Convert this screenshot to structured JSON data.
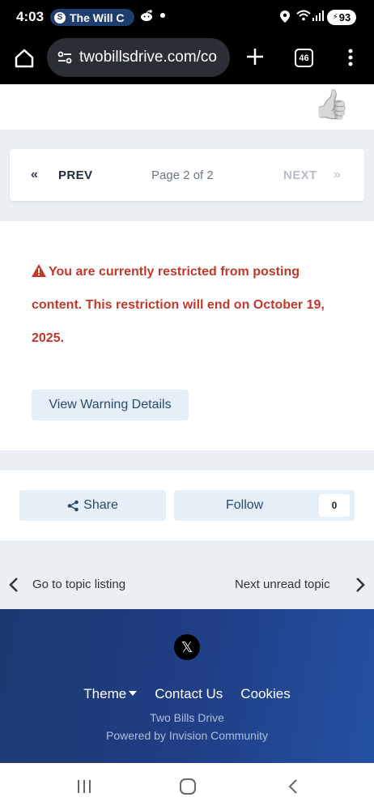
{
  "status_bar": {
    "time": "4:03",
    "notification_pill": "The Will C",
    "battery": "93"
  },
  "browser": {
    "url": "twobillsdrive.com/co",
    "tab_count": "46"
  },
  "pagination": {
    "prev_label": "PREV",
    "page_info": "Page 2 of 2",
    "next_label": "NEXT"
  },
  "restriction": {
    "message": "You are currently restricted from posting content. This restriction will end on October 19, 2025.",
    "button_label": "View Warning Details",
    "color": "#c0392b"
  },
  "actions": {
    "share_label": "Share",
    "follow_label": "Follow",
    "follow_count": "0"
  },
  "topic_nav": {
    "back_label": "Go to topic listing",
    "next_label": "Next unread topic"
  },
  "footer": {
    "links": [
      "Theme",
      "Contact Us",
      "Cookies"
    ],
    "site_name": "Two Bills Drive",
    "powered_by": "Powered by Invision Community",
    "social_icon": "x-icon"
  }
}
